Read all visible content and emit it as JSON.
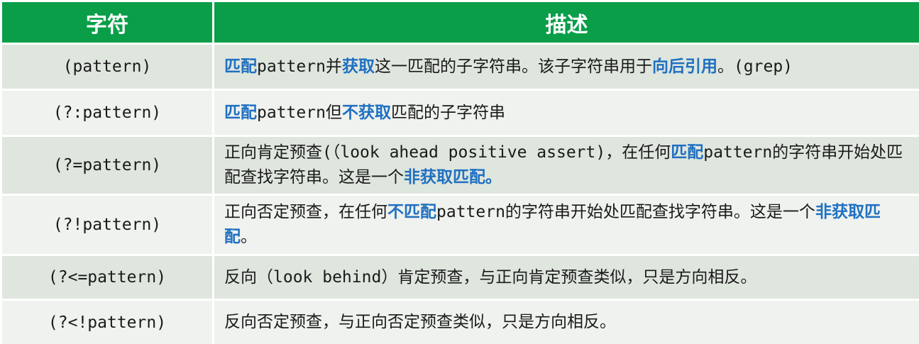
{
  "header": {
    "col1": "字符",
    "col2": "描述"
  },
  "rows": [
    {
      "pattern": "(pattern)",
      "parts": [
        {
          "text": "匹配",
          "hl": true
        },
        {
          "text": "pattern并",
          "hl": false
        },
        {
          "text": "获取",
          "hl": true
        },
        {
          "text": "这一匹配的子字符串。该子字符串用于",
          "hl": false
        },
        {
          "text": "向后引用",
          "hl": true
        },
        {
          "text": "。(grep)",
          "hl": false
        }
      ]
    },
    {
      "pattern": "(?:pattern)",
      "parts": [
        {
          "text": "匹配",
          "hl": true
        },
        {
          "text": "pattern但",
          "hl": false
        },
        {
          "text": "不获取",
          "hl": true
        },
        {
          "text": "匹配的子字符串",
          "hl": false
        }
      ]
    },
    {
      "pattern": "(?=pattern)",
      "parts": [
        {
          "text": "正向肯定预查(（look ahead positive assert)，在任何",
          "hl": false
        },
        {
          "text": "匹配",
          "hl": true
        },
        {
          "text": "pattern的字符串开始处匹配查找字符串。这是一个",
          "hl": false
        },
        {
          "text": "非获取匹配。",
          "hl": true
        }
      ]
    },
    {
      "pattern": "(?!pattern)",
      "parts": [
        {
          "text": "正向否定预查，在任何",
          "hl": false
        },
        {
          "text": "不匹配",
          "hl": true
        },
        {
          "text": "pattern的字符串开始处匹配查找字符串。这是一个",
          "hl": false
        },
        {
          "text": "非获取匹配",
          "hl": true
        },
        {
          "text": "。",
          "hl": false
        }
      ]
    },
    {
      "pattern": "(?<=pattern)",
      "parts": [
        {
          "text": "反向（look behind）肯定预查，与正向肯定预查类似，只是方向相反。",
          "hl": false
        }
      ]
    },
    {
      "pattern": "(?<!pattern)",
      "parts": [
        {
          "text": "反向否定预查，与正向否定预查类似，只是方向相反。",
          "hl": false
        }
      ]
    }
  ],
  "colors": {
    "header_bg": "#0a9e49",
    "row_bg": "#dfe6de",
    "row_alt_bg": "#eff2ee",
    "highlight": "#1f70c1"
  }
}
